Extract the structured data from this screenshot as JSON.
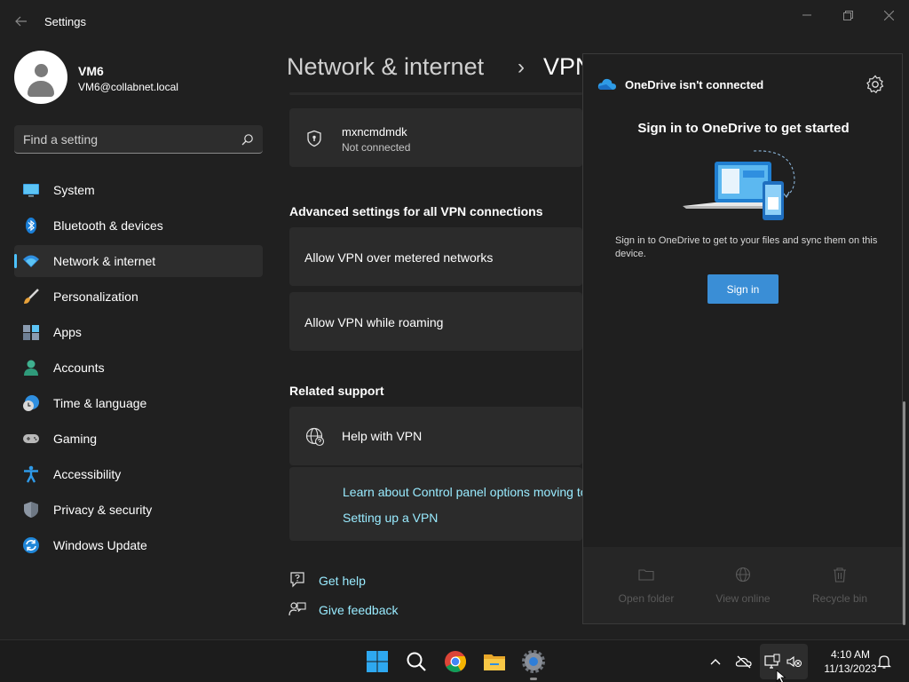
{
  "window": {
    "title": "Settings"
  },
  "profile": {
    "name": "VM6",
    "email": "VM6@collabnet.local"
  },
  "search": {
    "placeholder": "Find a setting"
  },
  "sidebar": {
    "active_index": 2,
    "items": [
      {
        "label": "System",
        "icon": "monitor-icon"
      },
      {
        "label": "Bluetooth & devices",
        "icon": "bluetooth-icon"
      },
      {
        "label": "Network & internet",
        "icon": "wifi-icon"
      },
      {
        "label": "Personalization",
        "icon": "brush-icon"
      },
      {
        "label": "Apps",
        "icon": "apps-icon"
      },
      {
        "label": "Accounts",
        "icon": "person-icon"
      },
      {
        "label": "Time & language",
        "icon": "clock-globe-icon"
      },
      {
        "label": "Gaming",
        "icon": "gamepad-icon"
      },
      {
        "label": "Accessibility",
        "icon": "accessibility-icon"
      },
      {
        "label": "Privacy & security",
        "icon": "shield-icon"
      },
      {
        "label": "Windows Update",
        "icon": "update-icon"
      }
    ]
  },
  "main": {
    "breadcrumb": [
      "Network & internet",
      "VPN"
    ],
    "breadcrumb_separator": "›",
    "vpn_connection": {
      "name": "mxncmdmdk",
      "status": "Not connected"
    },
    "advanced_heading": "Advanced settings for all VPN connections",
    "advanced_rows": [
      "Allow VPN over metered networks",
      "Allow VPN while roaming"
    ],
    "related_heading": "Related support",
    "help": {
      "label": "Help with VPN",
      "links": [
        "Learn about Control panel options moving to Settings",
        "Setting up a VPN"
      ]
    },
    "footer_links": {
      "get_help": "Get help",
      "give_feedback": "Give feedback"
    }
  },
  "onedrive": {
    "title": "OneDrive isn't connected",
    "heading": "Sign in to OneDrive to get started",
    "description": "Sign in to OneDrive to get to your files and sync them on this device.",
    "signin_label": "Sign in",
    "actions": [
      "Open folder",
      "View online",
      "Recycle bin"
    ],
    "accent": "#3a8ed6"
  },
  "taskbar": {
    "apps": [
      "start-icon",
      "search-icon",
      "chrome-icon",
      "file-explorer-icon",
      "settings-icon"
    ],
    "time": "4:10 AM",
    "date": "11/13/2023"
  },
  "colors": {
    "background": "#202020",
    "card": "#2b2b2b",
    "accent": "#4cc2ff",
    "link": "#99ebff"
  }
}
